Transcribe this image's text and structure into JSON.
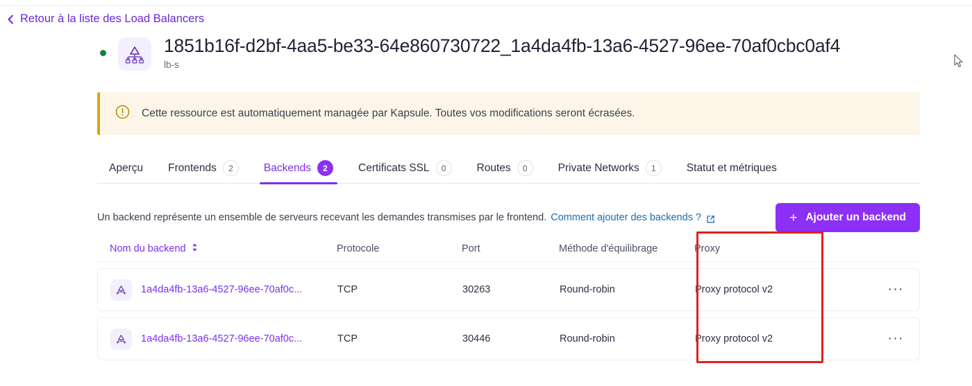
{
  "back_link": {
    "label": "Retour à la liste des Load Balancers",
    "icon": "chevron-left-icon"
  },
  "resource": {
    "title": "1851b16f-d2bf-4aa5-be33-64e860730722_1a4da4fb-13a6-4527-96ee-70af0cbc0af4",
    "subtitle": "lb-s",
    "status_color": "#17803d",
    "icon": "load-balancer-icon"
  },
  "banner": {
    "icon": "warning-circle-icon",
    "text": "Cette ressource est automatiquement managée par Kapsule. Toutes vos modifications seront écrasées.",
    "accent_color": "#d9a513",
    "background_color": "#fdf6e8"
  },
  "tabs": [
    {
      "label": "Aperçu",
      "count": null,
      "active": false
    },
    {
      "label": "Frontends",
      "count": "2",
      "active": false
    },
    {
      "label": "Backends",
      "count": "2",
      "active": true
    },
    {
      "label": "Certificats SSL",
      "count": "0",
      "active": false
    },
    {
      "label": "Routes",
      "count": "0",
      "active": false
    },
    {
      "label": "Private Networks",
      "count": "1",
      "active": false
    },
    {
      "label": "Statut et métriques",
      "count": null,
      "active": false
    }
  ],
  "description": {
    "text": "Un backend représente un ensemble de serveurs recevant les demandes transmises par le frontend.",
    "link_label": "Comment ajouter des backends ?",
    "link_icon": "external-link-icon",
    "link_color": "#1d6bb0"
  },
  "add_button": {
    "label": "Ajouter un backend",
    "icon": "plus-icon",
    "color": "#8c30f5"
  },
  "table": {
    "columns": [
      {
        "key": "name",
        "label": "Nom du backend",
        "sortable": true,
        "sort_icon": "sort-chevrons-icon"
      },
      {
        "key": "proto",
        "label": "Protocole",
        "sortable": false
      },
      {
        "key": "port",
        "label": "Port",
        "sortable": false
      },
      {
        "key": "method",
        "label": "Méthode d'équilibrage",
        "sortable": false
      },
      {
        "key": "proxy",
        "label": "Proxy",
        "sortable": false
      }
    ],
    "rows": [
      {
        "icon": "load-balancer-icon",
        "name": "1a4da4fb-13a6-4527-96ee-70af0c...",
        "proto": "TCP",
        "port": "30263",
        "method": "Round-robin",
        "proxy": "Proxy protocol v2",
        "menu": "···"
      },
      {
        "icon": "load-balancer-icon",
        "name": "1a4da4fb-13a6-4527-96ee-70af0c...",
        "proto": "TCP",
        "port": "30446",
        "method": "Round-robin",
        "proxy": "Proxy protocol v2",
        "menu": "···"
      }
    ]
  },
  "annotation": {
    "shape": "rectangle",
    "color": "#e02020",
    "target": "proxy-column"
  }
}
